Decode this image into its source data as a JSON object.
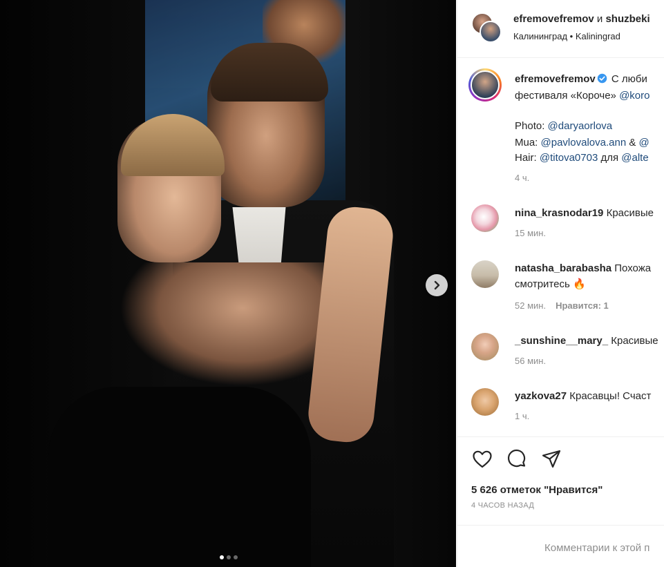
{
  "post": {
    "author": "efremovefremov",
    "conjunction": "и",
    "coauthor": "shuzbeki",
    "location": "Калининград • Kaliningrad",
    "caption": {
      "username": "efremovefremov",
      "line1_text": "С люби",
      "line2_text": "фестиваля «Короче» ",
      "line2_mention": "@koro",
      "credits": [
        {
          "label": "Photo: ",
          "mention1": "@daryaorlova",
          "sep": "",
          "mention2": ""
        },
        {
          "label": "Mua: ",
          "mention1": "@pavlovalova.ann",
          "sep": " & ",
          "mention2": "@"
        },
        {
          "label": "Hair: ",
          "mention1": "@titova0703",
          "sep": " для ",
          "mention2": "@alte"
        }
      ],
      "time": "4 ч."
    },
    "carousel": {
      "total": 3,
      "current": 1
    }
  },
  "comments": [
    {
      "username": "nina_krasnodar19",
      "text": "Красивые",
      "text2": "",
      "time": "15 мин.",
      "likes": ""
    },
    {
      "username": "natasha_barabasha",
      "text": "Похожа",
      "text2": "смотритесь 🔥",
      "time": "52 мин.",
      "likes": "Нравится: 1"
    },
    {
      "username": "_sunshine__mary_",
      "text": "Красивые",
      "text2": "",
      "time": "56 мин.",
      "likes": ""
    },
    {
      "username": "yazkova27",
      "text": "Красавцы! Счаст",
      "text2": "",
      "time": "1 ч.",
      "likes": ""
    }
  ],
  "actions": {
    "like_icon": "heart-icon",
    "comment_icon": "comment-icon",
    "share_icon": "share-icon",
    "likes_count": "5 626 отметок \"Нравится\"",
    "time_ago": "4 ЧАСОВ НАЗАД"
  },
  "add_comment": {
    "placeholder": "Комментарии к этой п"
  },
  "colors": {
    "link": "#1e4a7a",
    "verified": "#3897f0",
    "muted": "#8e8e8e"
  }
}
